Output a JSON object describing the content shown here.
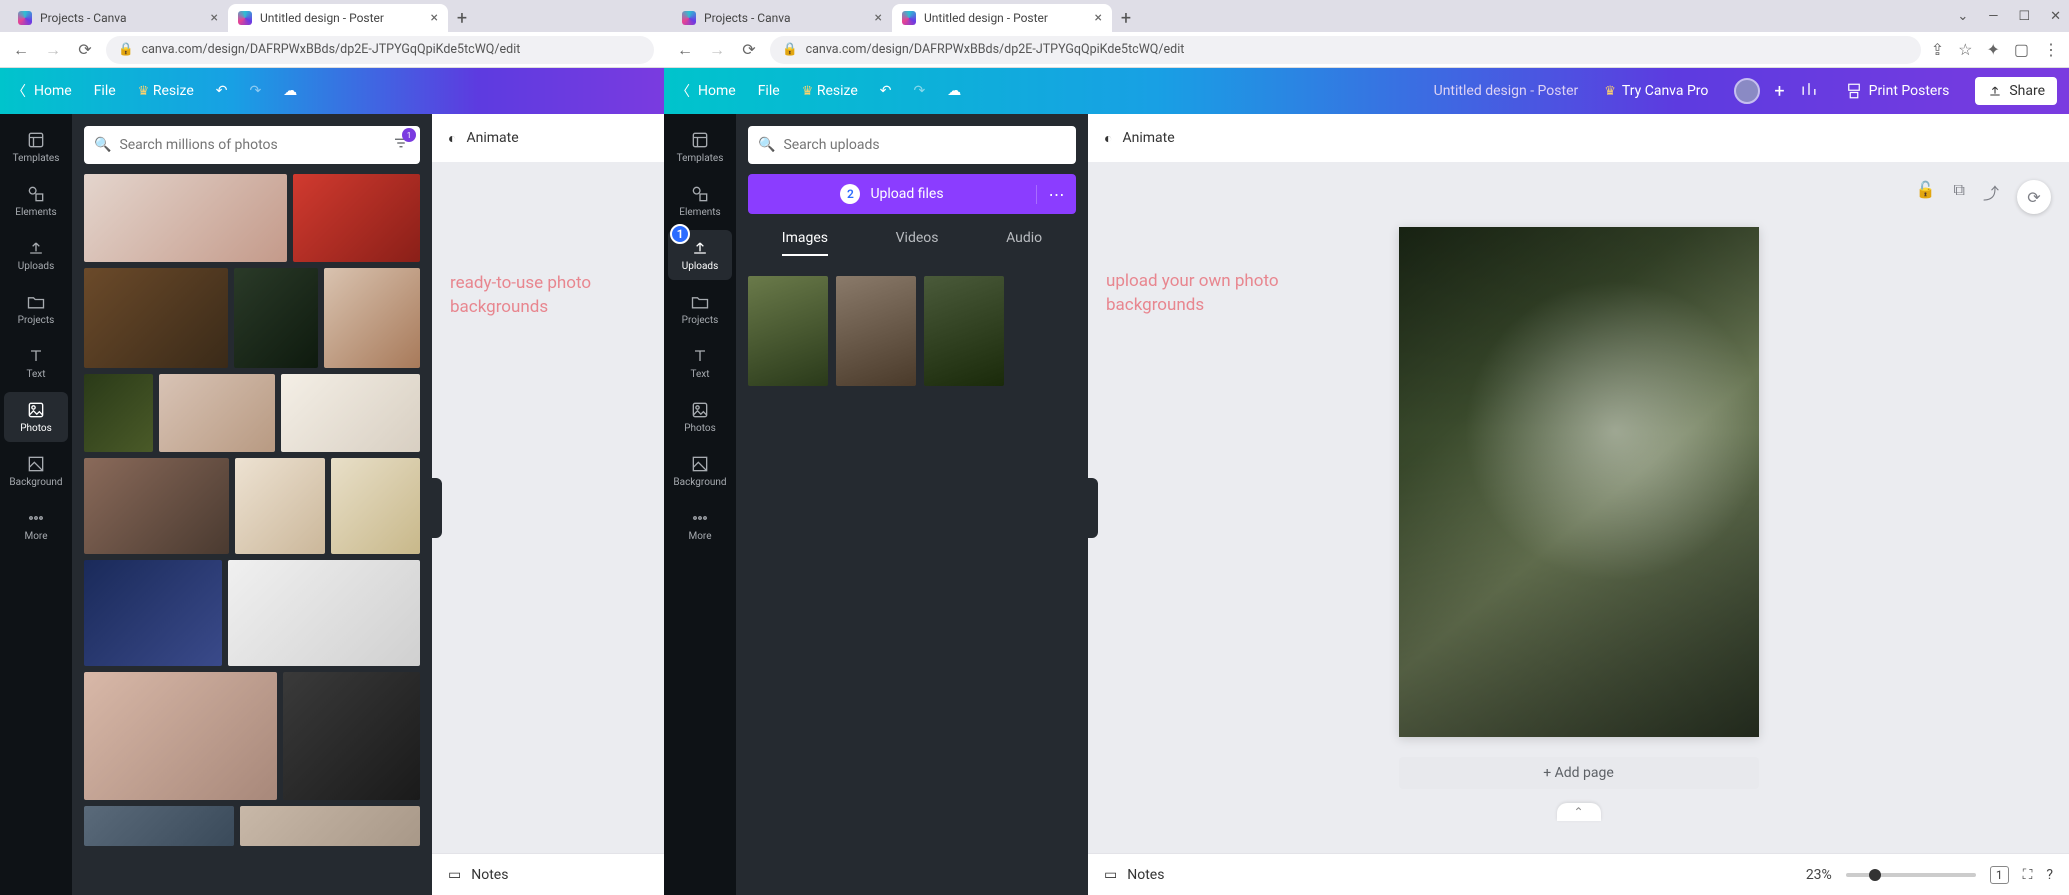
{
  "browser": {
    "tabs": [
      {
        "title": "Projects - Canva",
        "active": false
      },
      {
        "title": "Untitled design - Poster",
        "active": true
      }
    ],
    "url": "canva.com/design/DAFRPWxBBds/dp2E-JTPYGqQpiKde5tcWQ/edit"
  },
  "header": {
    "home": "Home",
    "file": "File",
    "resize": "Resize",
    "doc_name": "Untitled design - Poster",
    "try_pro": "Try Canva Pro",
    "print": "Print Posters",
    "share": "Share"
  },
  "rail": {
    "templates": "Templates",
    "elements": "Elements",
    "uploads": "Uploads",
    "projects": "Projects",
    "text": "Text",
    "photos": "Photos",
    "background": "Background",
    "more": "More"
  },
  "left_panel": {
    "search_placeholder": "Search millions of photos",
    "filter_badge": "1"
  },
  "right_panel": {
    "search_placeholder": "Search uploads",
    "upload_label": "Upload files",
    "badge1": "1",
    "badge2": "2",
    "tabs": {
      "images": "Images",
      "videos": "Videos",
      "audio": "Audio"
    }
  },
  "canvas": {
    "animate": "Animate",
    "notes": "Notes",
    "zoom": "23%",
    "pages_badge": "1",
    "add_page": "+ Add page"
  },
  "annotations": {
    "left": "ready-to-use photo\nbackgrounds",
    "right": "upload your own photo\nbackgrounds"
  }
}
